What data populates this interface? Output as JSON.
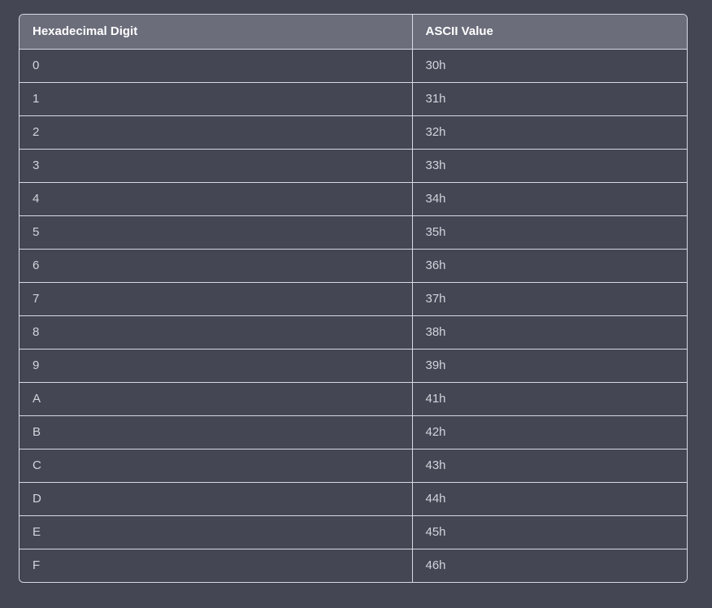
{
  "table": {
    "headers": [
      "Hexadecimal Digit",
      "ASCII Value"
    ],
    "rows": [
      [
        "0",
        "30h"
      ],
      [
        "1",
        "31h"
      ],
      [
        "2",
        "32h"
      ],
      [
        "3",
        "33h"
      ],
      [
        "4",
        "34h"
      ],
      [
        "5",
        "35h"
      ],
      [
        "6",
        "36h"
      ],
      [
        "7",
        "37h"
      ],
      [
        "8",
        "38h"
      ],
      [
        "9",
        "39h"
      ],
      [
        "A",
        "41h"
      ],
      [
        "B",
        "42h"
      ],
      [
        "C",
        "43h"
      ],
      [
        "D",
        "44h"
      ],
      [
        "E",
        "45h"
      ],
      [
        "F",
        "46h"
      ]
    ]
  },
  "colors": {
    "background": "#444654",
    "header_background": "#6b6d7b",
    "border": "#d9d9e3",
    "header_text": "#ffffff",
    "body_text": "#d1d5db"
  }
}
